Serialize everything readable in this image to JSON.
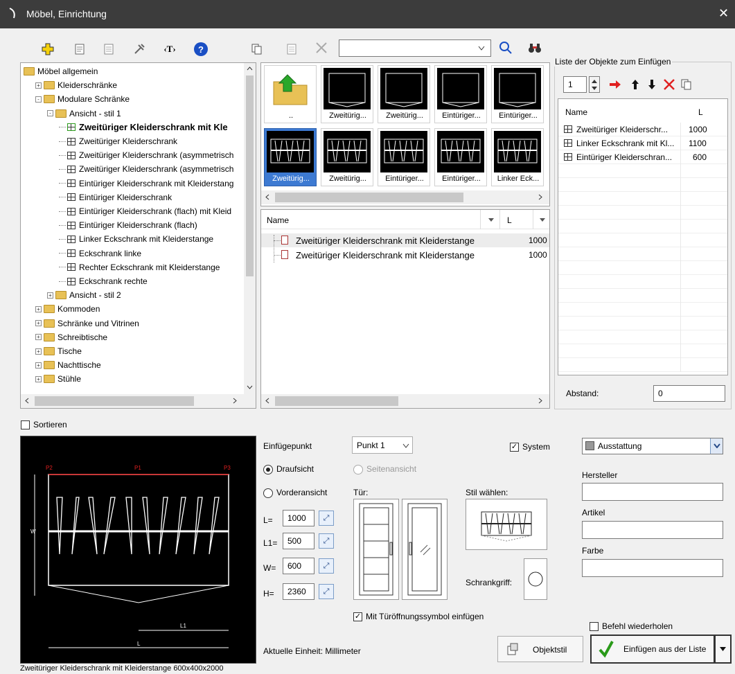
{
  "window": {
    "title": "Möbel, Einrichtung",
    "close_glyph": "✕"
  },
  "toolbar": {
    "search_value": "",
    "icons": [
      "add-icon",
      "properties-icon",
      "document-icon",
      "tools-icon",
      "text-icon",
      "help-icon",
      "copy-icon",
      "list-icon",
      "delete-icon",
      "search-icon",
      "find-icon"
    ],
    "text_tool_label": "‹T›",
    "help_label": "?"
  },
  "tree": {
    "items": [
      {
        "label": "Möbel allgemein"
      },
      {
        "label": "Kleiderschränke"
      },
      {
        "label": "Modulare Schränke"
      },
      {
        "label": "Ansicht - stil 1"
      },
      {
        "label": "Zweitüriger Kleiderschrank mit Kle"
      },
      {
        "label": "Zweitüriger Kleiderschrank"
      },
      {
        "label": "Zweitüriger Kleiderschrank (asymmetrisch"
      },
      {
        "label": "Zweitüriger Kleiderschrank (asymmetrisch"
      },
      {
        "label": "Eintüriger Kleiderschrank mit Kleiderstang"
      },
      {
        "label": "Eintüriger Kleiderschrank"
      },
      {
        "label": "Eintüriger Kleiderschrank (flach) mit Kleid"
      },
      {
        "label": "Eintüriger Kleiderschrank (flach)"
      },
      {
        "label": "Linker Eckschrank mit Kleiderstange"
      },
      {
        "label": "Eckschrank linke"
      },
      {
        "label": "Rechter Eckschrank mit Kleiderstange"
      },
      {
        "label": "Eckschrank rechte"
      },
      {
        "label": "Ansicht - stil 2"
      },
      {
        "label": "Kommoden"
      },
      {
        "label": "Schränke und Vitrinen"
      },
      {
        "label": "Schreibtische"
      },
      {
        "label": "Tische"
      },
      {
        "label": "Nachttische"
      },
      {
        "label": "Stühle"
      }
    ]
  },
  "tiles": {
    "row1": [
      "..",
      "Zweitürig...",
      "Zweitürig...",
      "Eintüriger...",
      "Eintüriger..."
    ],
    "row2": [
      "Zweitürig...",
      "Zweitürig...",
      "Eintüriger...",
      "Eintüriger...",
      "Linker Eck..."
    ]
  },
  "list": {
    "col_name": "Name",
    "col_l": "L",
    "rows": [
      {
        "name": "Zweitüriger Kleiderschrank mit Kleiderstange",
        "l": "1000"
      },
      {
        "name": "Zweitüriger Kleiderschrank mit Kleiderstange",
        "l": "1000"
      }
    ]
  },
  "insert_list": {
    "group_title": "Liste der Objekte zum Einfügen",
    "count": "1",
    "col_name": "Name",
    "col_l": "L",
    "rows": [
      {
        "name": "Zweitüriger Kleiderschr...",
        "l": "1000"
      },
      {
        "name": "Linker Eckschrank mit Kl...",
        "l": "1100"
      },
      {
        "name": "Eintüriger Kleiderschran...",
        "l": "600"
      }
    ],
    "abstand_label": "Abstand:",
    "abstand_value": "0"
  },
  "preview": {
    "sort_label": "Sortieren",
    "caption": "Zweitüriger Kleiderschrank mit Kleiderstange 600x400x2000",
    "markers": [
      "P2",
      "P1",
      "P3"
    ],
    "dims": [
      "W",
      "L1",
      "L"
    ]
  },
  "params": {
    "insert_point_label": "Einfügepunkt",
    "insert_point_value": "Punkt 1",
    "top_view": "Draufsicht",
    "side_view": "Seitenansicht",
    "front_view": "Vorderansicht",
    "system_label": "System",
    "fields": [
      {
        "label": "L=",
        "value": "1000"
      },
      {
        "label": "L1=",
        "value": "500"
      },
      {
        "label": "W=",
        "value": "600"
      },
      {
        "label": "H=",
        "value": "2360"
      }
    ],
    "door_label": "Tür:",
    "style_label": "Stil wählen:",
    "handle_label": "Schrankgriff:",
    "door_symbol_label": "Mit Türöffnungssymbol einfügen",
    "unit_label": "Aktuelle Einheit: Millimeter"
  },
  "attributes": {
    "category_value": "Ausstattung",
    "manufacturer_label": "Hersteller",
    "article_label": "Artikel",
    "color_label": "Farbe"
  },
  "bottom": {
    "repeat_label": "Befehl wiederholen",
    "object_style_label": "Objektstil",
    "insert_button_label": "Einfügen aus der Liste"
  },
  "colors": {
    "titlebar": "#3c3c3c",
    "selection": "#3d7ad2",
    "accent_red": "#e02020"
  }
}
